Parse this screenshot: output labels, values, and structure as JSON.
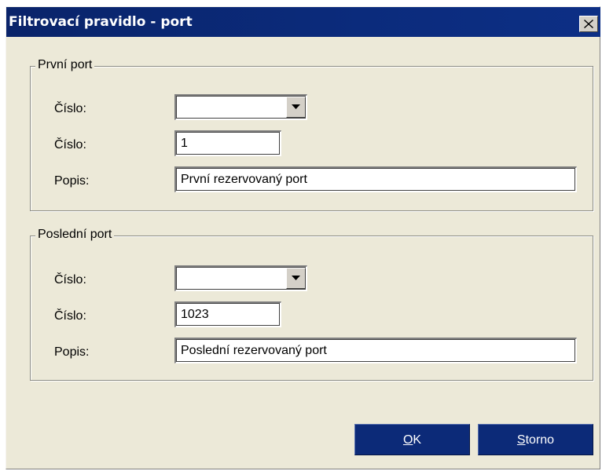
{
  "window": {
    "title": "Filtrovací pravidlo - port",
    "close_label": "×"
  },
  "first_port": {
    "legend": "První port",
    "combo_label": "Číslo:",
    "combo_value": "",
    "number_label": "Číslo:",
    "number_value": "1",
    "description_label": "Popis:",
    "description_value": "První rezervovaný port"
  },
  "last_port": {
    "legend": "Poslední port",
    "combo_label": "Číslo:",
    "combo_value": "",
    "number_label": "Číslo:",
    "number_value": "1023",
    "description_label": "Popis:",
    "description_value": "Poslední rezervovaný port"
  },
  "buttons": {
    "ok_mnemonic": "O",
    "ok_rest": "K",
    "cancel_mnemonic": "S",
    "cancel_rest": "torno"
  },
  "colors": {
    "titlebar": "#0a246a",
    "dialog_background": "#ece9d8",
    "button_background": "#0c2a78"
  },
  "icons": {
    "close": "close-icon",
    "dropdown": "chevron-down-icon"
  }
}
